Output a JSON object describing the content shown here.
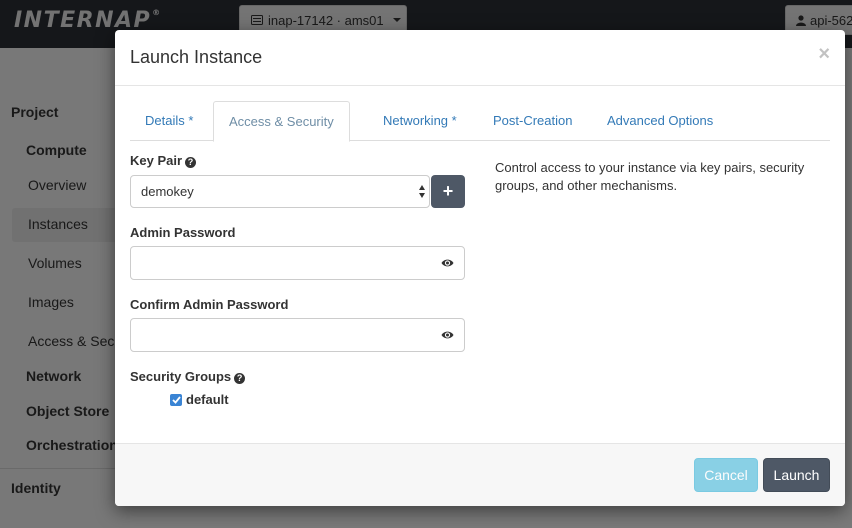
{
  "topbar": {
    "logo": "INTERNAP",
    "logo_mark": "®",
    "project_selector": "inap-17142 · ams01",
    "user_menu": "api-562"
  },
  "sidebar": {
    "project": "Project",
    "compute": "Compute",
    "items": [
      "Overview",
      "Instances",
      "Volumes",
      "Images",
      "Access & Secu"
    ],
    "network": "Network",
    "object_store": "Object Store",
    "orchestration": "Orchestration",
    "identity": "Identity"
  },
  "modal": {
    "title": "Launch Instance",
    "close": "×",
    "tabs": [
      {
        "label": "Details *"
      },
      {
        "label": "Access & Security"
      },
      {
        "label": "Networking *"
      },
      {
        "label": "Post-Creation"
      },
      {
        "label": "Advanced Options"
      }
    ],
    "active_tab": "Access & Security",
    "key_pair": {
      "label": "Key Pair",
      "value": "demokey",
      "add": "+"
    },
    "admin_password": {
      "label": "Admin Password",
      "value": ""
    },
    "confirm_password": {
      "label": "Confirm Admin Password",
      "value": ""
    },
    "security_groups": {
      "label": "Security Groups",
      "options": [
        {
          "label": "default",
          "checked": true
        }
      ]
    },
    "help_text": "Control access to your instance via key pairs, security groups, and other mechanisms.",
    "footer": {
      "cancel": "Cancel",
      "launch": "Launch"
    }
  },
  "colors": {
    "primary": "#4e5866",
    "info": "#5bc0de",
    "link": "#337ab7",
    "checkbox": "#3a84d4"
  }
}
